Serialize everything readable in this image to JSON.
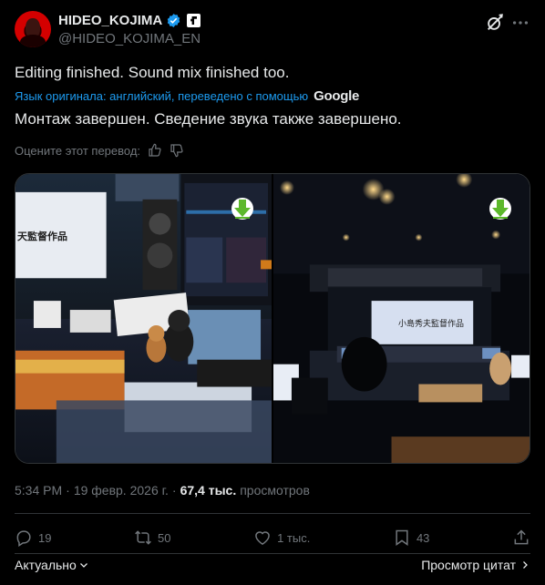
{
  "author": {
    "name": "HIDEO_KOJIMA",
    "handle": "@HIDEO_KOJIMA_EN"
  },
  "tweet": {
    "text_original": "Editing finished. Sound mix finished too.",
    "translation_note": "Язык оригинала: английский, переведено с помощью",
    "translation_provider": "Google",
    "text_translated": "Монтаж завершен. Сведение звука также завершено.",
    "rate_prompt": "Оцените этот перевод:"
  },
  "media": {
    "left_screen_text": "天監督作品",
    "right_screen_text": "小島秀夫監督作品"
  },
  "meta": {
    "time": "5:34 PM",
    "separator": "·",
    "date": "19 февр. 2026 г.",
    "views_count": "67,4 тыс.",
    "views_label": "просмотров"
  },
  "actions": {
    "replies": "19",
    "reposts": "50",
    "likes": "1 тыс.",
    "bookmarks": "43"
  },
  "footer": {
    "sort_label": "Актуально",
    "quotes_label": "Просмотр цитат"
  },
  "colors": {
    "accent": "#1d9bf0",
    "muted": "#71767b",
    "text": "#e7e9ea",
    "border": "#2f3336",
    "download_badge": "#5cb82b"
  }
}
